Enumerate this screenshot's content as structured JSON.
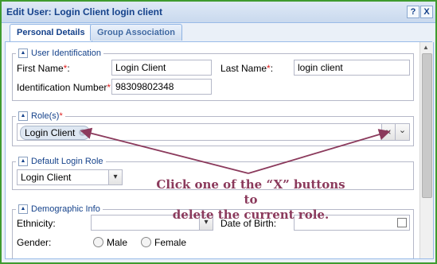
{
  "window": {
    "title": "Edit User: Login Client login client",
    "help_btn": "?",
    "close_btn": "X"
  },
  "tabs": [
    {
      "label": "Personal Details"
    },
    {
      "label": "Group Association"
    }
  ],
  "user_identification": {
    "legend": "User Identification",
    "first_name_label": "First Name",
    "first_name_value": "Login Client",
    "last_name_label": "Last Name",
    "last_name_value": "login client",
    "id_number_label": "Identification Number",
    "id_number_value": "98309802348",
    "required_mark": "*",
    "colon": ":"
  },
  "roles": {
    "legend": "Role(s)",
    "required_mark": "*",
    "chip": "Login Client",
    "chip_x": "×",
    "clear_x": "×",
    "dropdown": "⌄"
  },
  "default_login_role": {
    "legend": "Default Login Role",
    "value": "Login Client"
  },
  "demographic": {
    "legend": "Demographic Info",
    "ethnicity_label": "Ethnicity:",
    "ethnicity_value": "",
    "dob_label": "Date of Birth:",
    "dob_value": "",
    "gender_label": "Gender:",
    "male": "Male",
    "female": "Female"
  },
  "callout": {
    "line1": "Click one of the “X” buttons to",
    "line2": "delete the current role."
  },
  "colors": {
    "frame": "#3f9b2f",
    "callout": "#8b3a5c",
    "header_text": "#15428b"
  }
}
